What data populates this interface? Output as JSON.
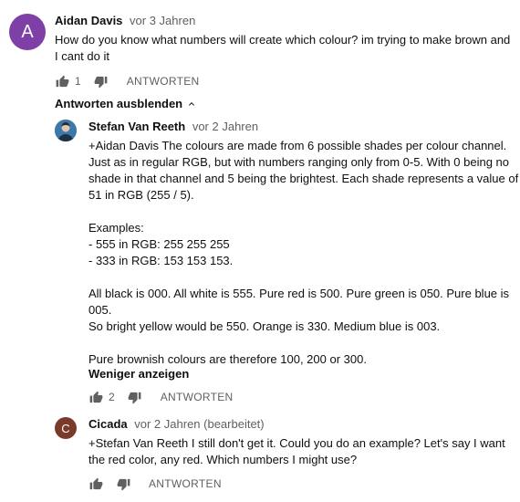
{
  "comment": {
    "avatar_letter": "A",
    "author": "Aidan Davis",
    "time": "vor 3 Jahren",
    "lines": [
      "How do you know what numbers will create which colour? im trying to make brown and",
      "I cant do it"
    ],
    "likes": "1",
    "reply_label": "ANTWORTEN"
  },
  "hide_replies_label": "Antworten ausblenden",
  "reply1": {
    "author": "Stefan Van Reeth",
    "time": "vor 2 Jahren",
    "lines": [
      "+Aidan Davis The colours are made from 6 possible shades per colour channel.",
      "Just as in regular RGB, but with numbers ranging only from 0-5. With 0 being no",
      "shade in that channel and 5 being the brightest. Each shade represents a value of",
      "51 in RGB (255 / 5).",
      "",
      "Examples:",
      "- 555 in RGB: 255 255 255",
      "- 333 in RGB: 153 153 153.",
      "",
      "All black is 000. All white is 555. Pure red is 500. Pure green is 050. Pure blue is",
      "005.",
      "So bright yellow would be 550. Orange is 330. Medium blue is 003.",
      "",
      "Pure brownish colours are therefore 100, 200 or 300."
    ],
    "show_less_label": "Weniger anzeigen",
    "likes": "2",
    "reply_label": "ANTWORTEN"
  },
  "reply2": {
    "avatar_letter": "C",
    "author": "Cicada",
    "time": "vor 2 Jahren (bearbeitet)",
    "lines": [
      "+Stefan Van Reeth I still don't get it. Could you do an example? Let's say I want",
      "the red color, any red. Which numbers I might use?"
    ],
    "reply_label": "ANTWORTEN"
  },
  "colors": {
    "main_avatar": "#7e3fa6",
    "cicada_avatar": "#7a3a2a",
    "secondary_text": "#606060"
  }
}
